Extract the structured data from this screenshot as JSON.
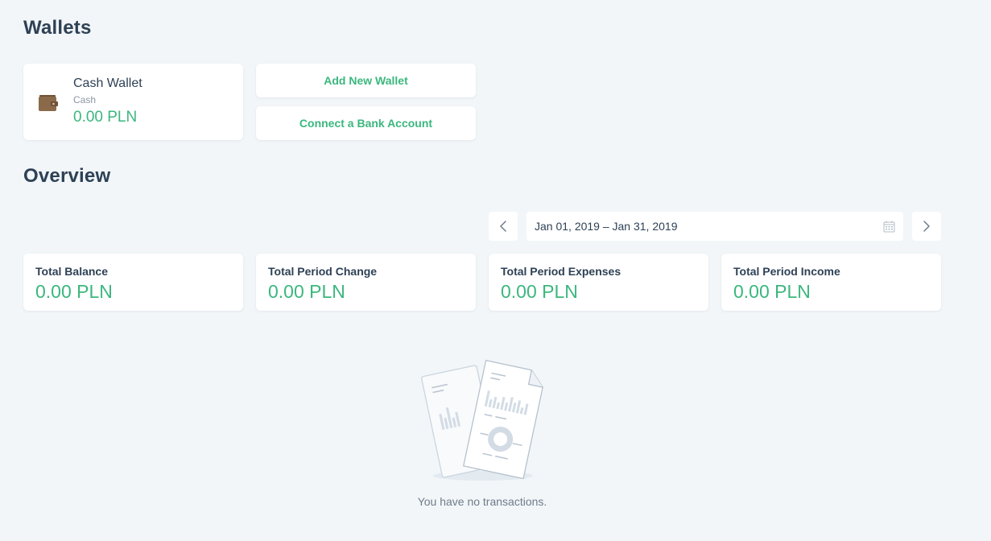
{
  "wallets_section": {
    "title": "Wallets",
    "wallet": {
      "name": "Cash Wallet",
      "type": "Cash",
      "balance": "0.00 PLN",
      "icon": "wallet-icon"
    },
    "add_wallet_label": "Add New Wallet",
    "connect_bank_label": "Connect a Bank Account"
  },
  "overview_section": {
    "title": "Overview",
    "date_range": "Jan 01, 2019 – Jan 31, 2019",
    "prev_icon": "chevron-left-icon",
    "next_icon": "chevron-right-icon",
    "calendar_icon": "calendar-icon",
    "stats": [
      {
        "label": "Total Balance",
        "value": "0.00 PLN"
      },
      {
        "label": "Total Period Change",
        "value": "0.00 PLN"
      },
      {
        "label": "Total Period Expenses",
        "value": "0.00 PLN"
      },
      {
        "label": "Total Period Income",
        "value": "0.00 PLN"
      }
    ],
    "empty_message": "You have no transactions."
  },
  "colors": {
    "background": "#f2f6f9",
    "card": "#ffffff",
    "accent": "#3bb77e",
    "heading": "#2e4155",
    "muted": "#8a97a5",
    "wallet_icon": "#8b6a4a"
  }
}
